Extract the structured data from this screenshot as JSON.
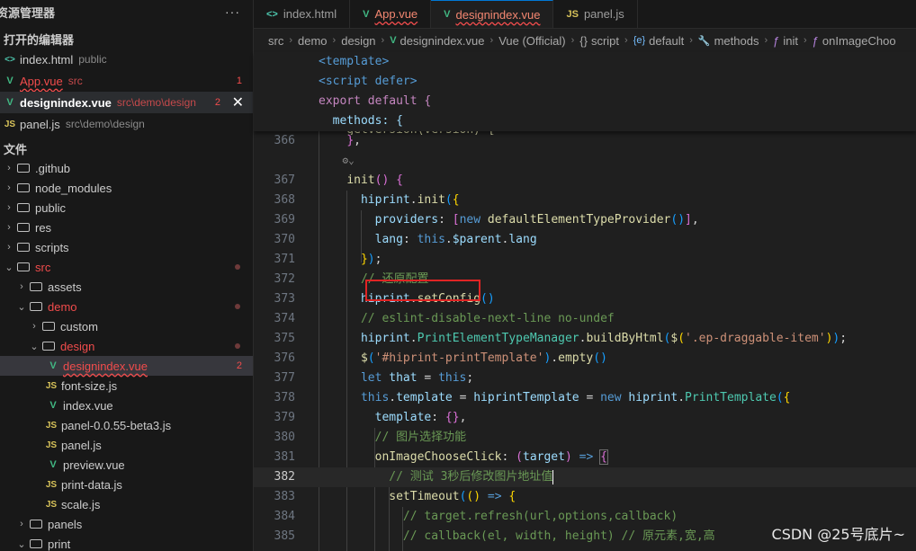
{
  "sidebar": {
    "title": "资源管理器",
    "more": "···",
    "open_editors_title": "打开的编辑器",
    "open_editors": [
      {
        "icon": "<>",
        "name": "index.html",
        "desc": "public"
      },
      {
        "icon": "V",
        "name": "App.vue",
        "desc": "src",
        "count": "1"
      },
      {
        "icon": "V",
        "name": "designindex.vue",
        "desc": "src\\demo\\design",
        "count": "2",
        "close": "✕"
      },
      {
        "icon": "JS",
        "name": "panel.js",
        "desc": "src\\demo\\design"
      }
    ],
    "files_title": "文件",
    "tree": [
      {
        "name": ".github"
      },
      {
        "name": "node_modules"
      },
      {
        "name": "public"
      },
      {
        "name": "res"
      },
      {
        "name": "scripts"
      },
      {
        "name": "src"
      },
      {
        "name": "assets"
      },
      {
        "name": "demo"
      },
      {
        "name": "custom"
      },
      {
        "name": "design"
      },
      {
        "icon": "V",
        "name": "designindex.vue",
        "count": "2"
      },
      {
        "icon": "JS",
        "name": "font-size.js"
      },
      {
        "icon": "V",
        "name": "index.vue"
      },
      {
        "icon": "JS",
        "name": "panel-0.0.55-beta3.js"
      },
      {
        "icon": "JS",
        "name": "panel.js"
      },
      {
        "icon": "V",
        "name": "preview.vue"
      },
      {
        "icon": "JS",
        "name": "print-data.js"
      },
      {
        "icon": "JS",
        "name": "scale.js"
      },
      {
        "name": "panels"
      },
      {
        "name": "print"
      }
    ]
  },
  "tabs": [
    {
      "icon": "<>",
      "label": "index.html"
    },
    {
      "icon": "V",
      "label": "App.vue"
    },
    {
      "icon": "V",
      "label": "designindex.vue"
    },
    {
      "icon": "JS",
      "label": "panel.js"
    }
  ],
  "breadcrumb": [
    "src",
    "demo",
    "design",
    "designindex.vue",
    "Vue (Official)",
    "script",
    "default",
    "methods",
    "init",
    "onImageChoo"
  ],
  "breadcrumb_icons": [
    "V",
    "{}",
    "{e}",
    "🔧",
    "ƒ",
    "ƒ"
  ],
  "sticky": [
    "<template>",
    "<script defer>",
    "export default {",
    "  methods: {",
    "    getVersion(version) {"
  ],
  "line_numbers": [
    "366",
    "367",
    "368",
    "369",
    "370",
    "371",
    "372",
    "373",
    "374",
    "375",
    "376",
    "377",
    "378",
    "379",
    "380",
    "381",
    "382",
    "383",
    "384",
    "385"
  ],
  "current_line": "382",
  "watermark": "CSDN @25号底片~",
  "colors": {
    "accent": "#0078d4",
    "error": "#f14c4c",
    "highlight_box": "#e02424"
  }
}
